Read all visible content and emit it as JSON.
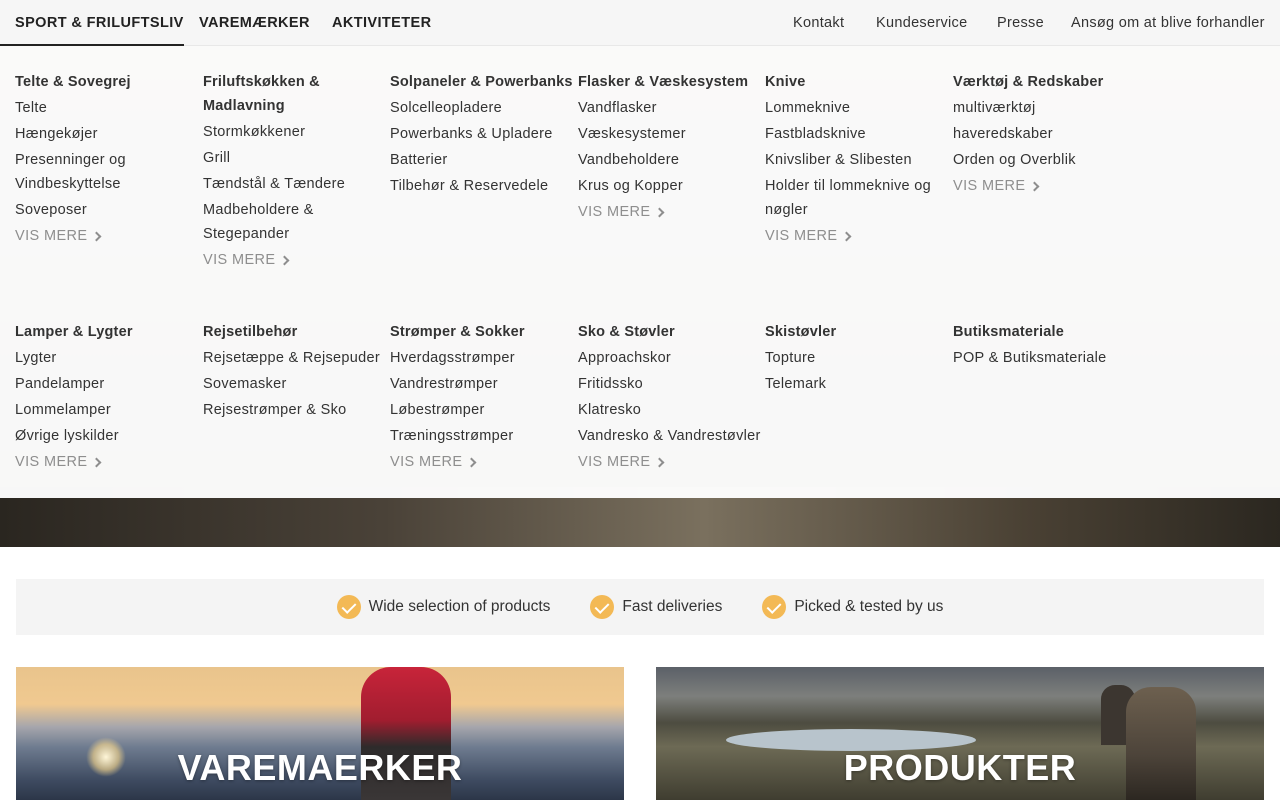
{
  "nav": {
    "tabs": [
      {
        "label": "SPORT & FRILUFTSLIV",
        "active": true
      },
      {
        "label": "VAREMÆRKER",
        "active": false
      },
      {
        "label": "AKTIVITETER",
        "active": false
      }
    ],
    "links": [
      "Kontakt",
      "Kundeservice",
      "Presse",
      "Ansøg om at blive forhandler"
    ]
  },
  "mega": {
    "more_label": "VIS MERE",
    "row1": [
      {
        "head": "Telte & Sovegrej",
        "items": [
          "Telte",
          "Hængekøjer",
          "Presenninger og Vindbeskyttelse",
          "Soveposer"
        ],
        "more": true
      },
      {
        "head": "Friluftskøkken & Madlavning",
        "items": [
          "Stormkøkkener",
          "Grill",
          "Tændstål & Tændere",
          "Madbeholdere & Stegepander"
        ],
        "more": true
      },
      {
        "head": "Solpaneler & Powerbanks",
        "items": [
          "Solcelleopladere",
          "Powerbanks & Upladere",
          "Batterier",
          "Tilbehør & Reservedele"
        ],
        "more": false
      },
      {
        "head": "Flasker & Væskesystem",
        "items": [
          "Vandflasker",
          "Væskesystemer",
          "Vandbeholdere",
          "Krus og Kopper"
        ],
        "more": true
      },
      {
        "head": "Knive",
        "items": [
          "Lommeknive",
          "Fastbladsknive",
          "Knivsliber & Slibesten",
          "Holder til lommeknive og nøgler"
        ],
        "more": true
      },
      {
        "head": "Værktøj & Redskaber",
        "items": [
          "multiværktøj",
          "haveredskaber",
          "Orden og Overblik"
        ],
        "more": true
      }
    ],
    "row2": [
      {
        "head": "Lamper & Lygter",
        "items": [
          "Lygter",
          "Pandelamper",
          "Lommelamper",
          "Øvrige lyskilder"
        ],
        "more": true
      },
      {
        "head": "Rejsetilbehør",
        "items": [
          "Rejsetæppe & Rejsepuder",
          "Sovemasker",
          "Rejsestrømper & Sko"
        ],
        "more": false
      },
      {
        "head": "Strømper & Sokker",
        "items": [
          "Hverdagsstrømper",
          "Vandrestrømper",
          "Løbestrømper",
          "Træningsstrømper"
        ],
        "more": true
      },
      {
        "head": "Sko & Støvler",
        "items": [
          "Approachskor",
          "Fritidssko",
          "Klatresko",
          "Vandresko & Vandrestøvler"
        ],
        "more": true
      },
      {
        "head": "Skistøvler",
        "items": [
          "Topture",
          "Telemark"
        ],
        "more": false
      },
      {
        "head": "Butiksmateriale",
        "items": [
          "POP & Butiksmateriale"
        ],
        "more": false
      }
    ]
  },
  "usp": [
    "Wide selection of products",
    "Fast deliveries",
    "Picked & tested by us"
  ],
  "cards": {
    "brands": "VAREMAERKER",
    "products": "PRODUKTER"
  },
  "colors": {
    "accent_check": "#f3b955",
    "nav_bg": "#f6f6f6",
    "usp_bg": "#f4f4f4"
  },
  "icons": {
    "check": "check-icon",
    "more": "chevron-right-icon"
  }
}
